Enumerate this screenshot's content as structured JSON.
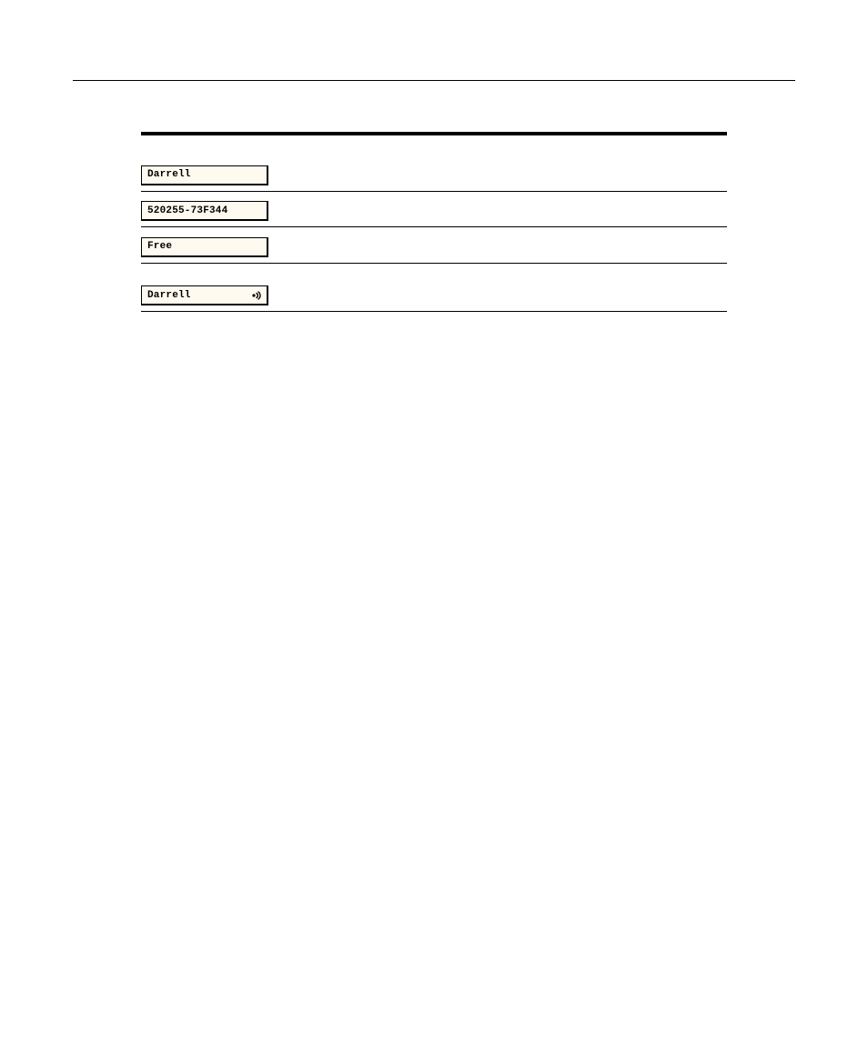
{
  "fields": {
    "name": "Darrell",
    "code": "520255-73F344",
    "status": "Free",
    "audio_name": "Darrell"
  }
}
